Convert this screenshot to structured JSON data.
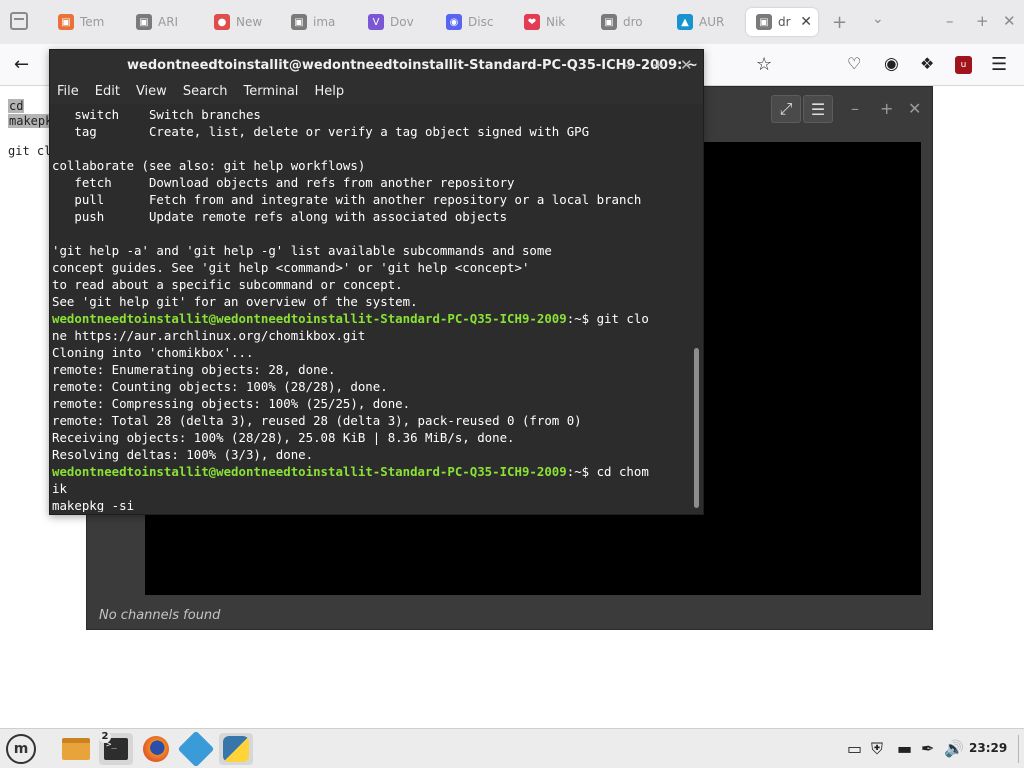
{
  "browser": {
    "tabs": [
      {
        "label": "Tem",
        "fav_color": "#e8713c",
        "fav_glyph": "▣"
      },
      {
        "label": "ARI",
        "fav_color": "#7a7a7a",
        "fav_glyph": "▣"
      },
      {
        "label": "New",
        "fav_color": "#e04d4d",
        "fav_glyph": "●"
      },
      {
        "label": "ima",
        "fav_color": "#7a7a7a",
        "fav_glyph": "▣"
      },
      {
        "label": "Dov",
        "fav_color": "#7b57d6",
        "fav_glyph": "V"
      },
      {
        "label": "Disc",
        "fav_color": "#5865f2",
        "fav_glyph": "◉"
      },
      {
        "label": "Nik",
        "fav_color": "#e43b55",
        "fav_glyph": "❤"
      },
      {
        "label": "dro",
        "fav_color": "#7a7a7a",
        "fav_glyph": "▣"
      },
      {
        "label": "AUR",
        "fav_color": "#1793d1",
        "fav_glyph": "▲"
      },
      {
        "label": "dr",
        "fav_color": "#7a7a7a",
        "fav_glyph": "▣"
      }
    ],
    "page_fragments": [
      "cd",
      "makepk",
      "git cl"
    ]
  },
  "channels_window": {
    "status": "No channels found"
  },
  "terminal": {
    "title": "wedontneedtoinstallit@wedontneedtoinstallit-Standard-PC-Q35-ICH9-2009: ~",
    "menu": [
      "File",
      "Edit",
      "View",
      "Search",
      "Terminal",
      "Help"
    ],
    "lines": [
      {
        "text": "   switch    Switch branches"
      },
      {
        "text": "   tag       Create, list, delete or verify a tag object signed with GPG"
      },
      {
        "text": ""
      },
      {
        "text": "collaborate (see also: git help workflows)"
      },
      {
        "text": "   fetch     Download objects and refs from another repository"
      },
      {
        "text": "   pull      Fetch from and integrate with another repository or a local branch"
      },
      {
        "text": "   push      Update remote refs along with associated objects"
      },
      {
        "text": ""
      },
      {
        "text": "'git help -a' and 'git help -g' list available subcommands and some"
      },
      {
        "text": "concept guides. See 'git help <command>' or 'git help <concept>'"
      },
      {
        "text": "to read about a specific subcommand or concept."
      },
      {
        "text": "See 'git help git' for an overview of the system."
      },
      {
        "prompt": "wedontneedtoinstallit@wedontneedtoinstallit-Standard-PC-Q35-ICH9-2009",
        "cmd": ":~$ git clo"
      },
      {
        "text": "ne https://aur.archlinux.org/chomikbox.git"
      },
      {
        "text": "Cloning into 'chomikbox'..."
      },
      {
        "text": "remote: Enumerating objects: 28, done."
      },
      {
        "text": "remote: Counting objects: 100% (28/28), done."
      },
      {
        "text": "remote: Compressing objects: 100% (25/25), done."
      },
      {
        "text": "remote: Total 28 (delta 3), reused 28 (delta 3), pack-reused 0 (from 0)"
      },
      {
        "text": "Receiving objects: 100% (28/28), 25.08 KiB | 8.36 MiB/s, done."
      },
      {
        "text": "Resolving deltas: 100% (3/3), done."
      },
      {
        "prompt": "wedontneedtoinstallit@wedontneedtoinstallit-Standard-PC-Q35-ICH9-2009",
        "cmd": ":~$ cd chom"
      },
      {
        "text": "ik"
      },
      {
        "text": "makepkg -si"
      }
    ]
  },
  "taskbar": {
    "terminal_badge": "2",
    "clock": "23:29"
  }
}
